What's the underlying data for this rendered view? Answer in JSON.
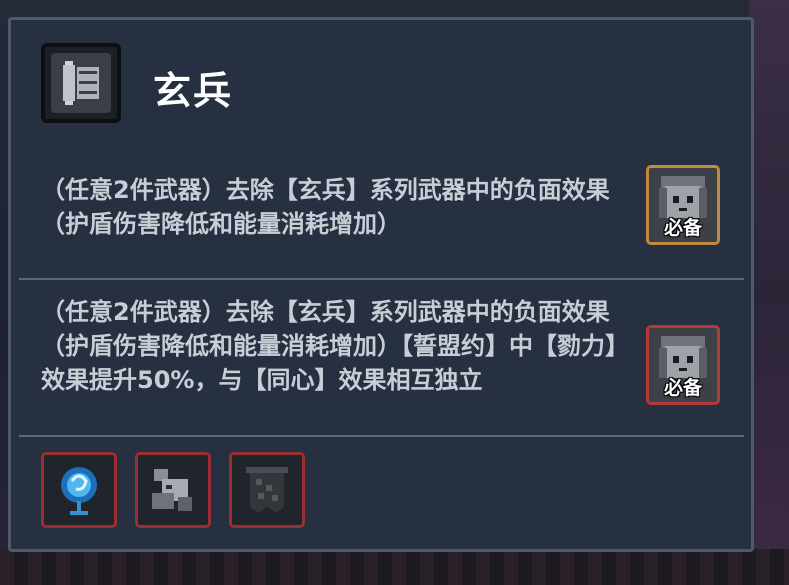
{
  "panel": {
    "title": "玄兵",
    "header_icon": "pillar-scroll-icon"
  },
  "entries": [
    {
      "text": "（任意2件武器）去除【玄兵】系列武器中的负面效果（护盾伤害降低和能量消耗增加）",
      "badge": {
        "label": "必备",
        "border_color": "#c08a3e",
        "icon": "armored-character-portrait-icon"
      }
    },
    {
      "text": "（任意2件武器）去除【玄兵】系列武器中的负面效果（护盾伤害降低和能量消耗增加）【誓盟约】中【勠力】效果提升50%，与【同心】效果相互独立",
      "badge": {
        "label": "必备",
        "border_color": "#b33a3a",
        "icon": "armored-character-portrait-icon"
      }
    }
  ],
  "weapons": [
    {
      "icon": "blue-spirit-orb-staff-icon"
    },
    {
      "icon": "stone-beast-gauntlet-icon"
    },
    {
      "icon": "dark-banner-shield-icon"
    }
  ],
  "colors": {
    "panel_bg": "#263040",
    "panel_border": "#4d5a6b",
    "text": "#c9ced6",
    "title": "#ffffff",
    "weapon_border": "#9a2f33"
  }
}
